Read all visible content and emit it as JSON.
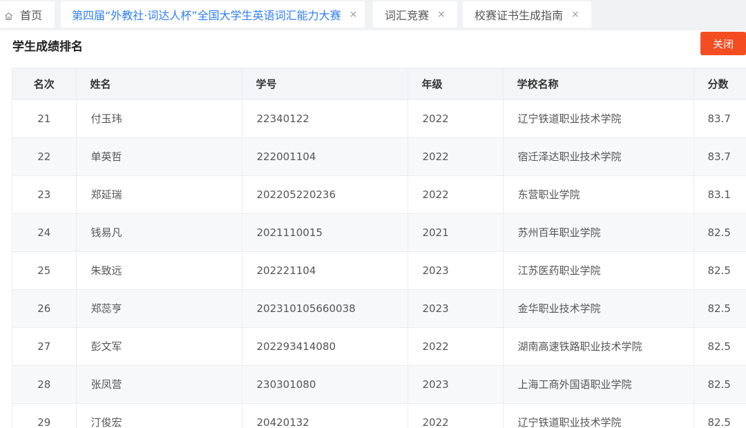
{
  "tabs": {
    "home": {
      "label": "首页"
    },
    "items": [
      {
        "label": "第四届“外教社·词达人杯”全国大学生英语词汇能力大赛",
        "close": "×"
      },
      {
        "label": "词汇竞赛",
        "close": "×"
      },
      {
        "label": "校赛证书生成指南",
        "close": "×"
      }
    ],
    "active_index": 0
  },
  "panel": {
    "title": "学生成绩排名",
    "close_label": "关闭"
  },
  "colors": {
    "accent": "#2f7ef5",
    "close_button": "#f44d22"
  },
  "table": {
    "headers": {
      "rank": "名次",
      "name": "姓名",
      "student_id": "学号",
      "grade": "年级",
      "school": "学校名称",
      "score": "分数"
    },
    "rows": [
      {
        "rank": "21",
        "name": "付玉玮",
        "student_id": "22340122",
        "grade": "2022",
        "school": "辽宁铁道职业技术学院",
        "score": "83.7"
      },
      {
        "rank": "22",
        "name": "单英哲",
        "student_id": "222001104",
        "grade": "2022",
        "school": "宿迁泽达职业技术学院",
        "score": "83.7"
      },
      {
        "rank": "23",
        "name": "郑延瑞",
        "student_id": "202205220236",
        "grade": "2022",
        "school": "东营职业学院",
        "score": "83.1"
      },
      {
        "rank": "24",
        "name": "钱易凡",
        "student_id": "2021110015",
        "grade": "2021",
        "school": "苏州百年职业学院",
        "score": "82.5"
      },
      {
        "rank": "25",
        "name": "朱致远",
        "student_id": "202221104",
        "grade": "2023",
        "school": "江苏医药职业学院",
        "score": "82.5"
      },
      {
        "rank": "26",
        "name": "郑蕊亨",
        "student_id": "202310105660038",
        "grade": "2023",
        "school": "金华职业技术学院",
        "score": "82.5"
      },
      {
        "rank": "27",
        "name": "彭文军",
        "student_id": "202293414080",
        "grade": "2022",
        "school": "湖南高速铁路职业技术学院",
        "score": "82.5"
      },
      {
        "rank": "28",
        "name": "张凤营",
        "student_id": "230301080",
        "grade": "2023",
        "school": "上海工商外国语职业学院",
        "score": "82.5"
      },
      {
        "rank": "29",
        "name": "汀俊宏",
        "student_id": "20420132",
        "grade": "2022",
        "school": "辽宁铁道职业技术学院",
        "score": "82.5"
      }
    ]
  }
}
